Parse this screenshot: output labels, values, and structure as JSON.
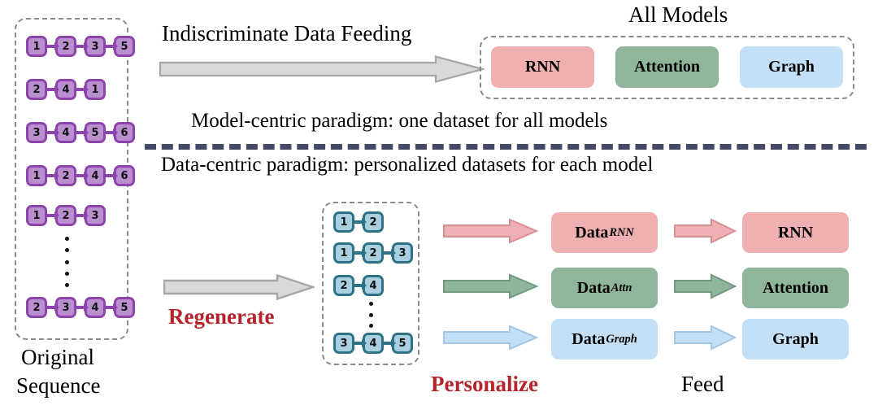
{
  "title": "Data-centric vs model-centric paradigm diagram",
  "colors": {
    "pink": "#f0b0b2",
    "green": "#8fb69b",
    "blue": "#c4e0f7",
    "purple_fill": "#b98fd0",
    "purple_border": "#8e44ad",
    "teal_fill": "#a9cfe0",
    "teal_border": "#2e7286",
    "gray_arrow_fill": "#d9d9d9",
    "gray_arrow_border": "#a6a6a6",
    "dashed_border": "#8a8a8a",
    "divider": "#454b67",
    "red_text": "#b3252a"
  },
  "original_panel": {
    "caption_line1": "Original",
    "caption_line2": "Sequence",
    "sequences": [
      [
        "1",
        "2",
        "3",
        "5"
      ],
      [
        "2",
        "4",
        "1"
      ],
      [
        "3",
        "4",
        "5",
        "6"
      ],
      [
        "1",
        "2",
        "4",
        "6"
      ],
      [
        "1",
        "2",
        "3"
      ],
      [
        "2",
        "3",
        "4",
        "5"
      ]
    ],
    "ellipsis": "vertical-dots"
  },
  "top_section": {
    "arrow_label": "Indiscriminate Data Feeding",
    "arrow_icon": "block-arrow-right-gray",
    "all_models_title": "All Models",
    "models": [
      {
        "label": "RNN",
        "color": "pink"
      },
      {
        "label": "Attention",
        "color": "green"
      },
      {
        "label": "Graph",
        "color": "blue"
      }
    ],
    "paradigm_caption": "Model-centric paradigm: one dataset for all models"
  },
  "divider": {
    "style": "dashed",
    "color": "#454b67"
  },
  "bottom_section": {
    "paradigm_caption": "Data-centric paradigm: personalized datasets for each model",
    "regenerate_label": "Regenerate",
    "regenerate_arrow_icon": "block-arrow-right-gray",
    "personalize_label": "Personalize",
    "feed_label": "Feed",
    "regenerated_panel": {
      "sequences": [
        [
          "1",
          "2"
        ],
        [
          "1",
          "2",
          "3"
        ],
        [
          "2",
          "4"
        ],
        [
          "3",
          "4",
          "5"
        ]
      ],
      "ellipsis": "vertical-dots"
    },
    "rows": [
      {
        "color": "pink",
        "personalize_arrow_icon": "block-arrow-right-pink",
        "data_label": "Data",
        "data_subscript": "RNN",
        "feed_arrow_icon": "block-arrow-right-pink",
        "model_label": "RNN"
      },
      {
        "color": "green",
        "personalize_arrow_icon": "block-arrow-right-green",
        "data_label": "Data",
        "data_subscript": "Attn",
        "feed_arrow_icon": "block-arrow-right-green",
        "model_label": "Attention"
      },
      {
        "color": "blue",
        "personalize_arrow_icon": "block-arrow-right-blue",
        "data_label": "Data",
        "data_subscript": "Graph",
        "feed_arrow_icon": "block-arrow-right-blue",
        "model_label": "Graph"
      }
    ]
  }
}
